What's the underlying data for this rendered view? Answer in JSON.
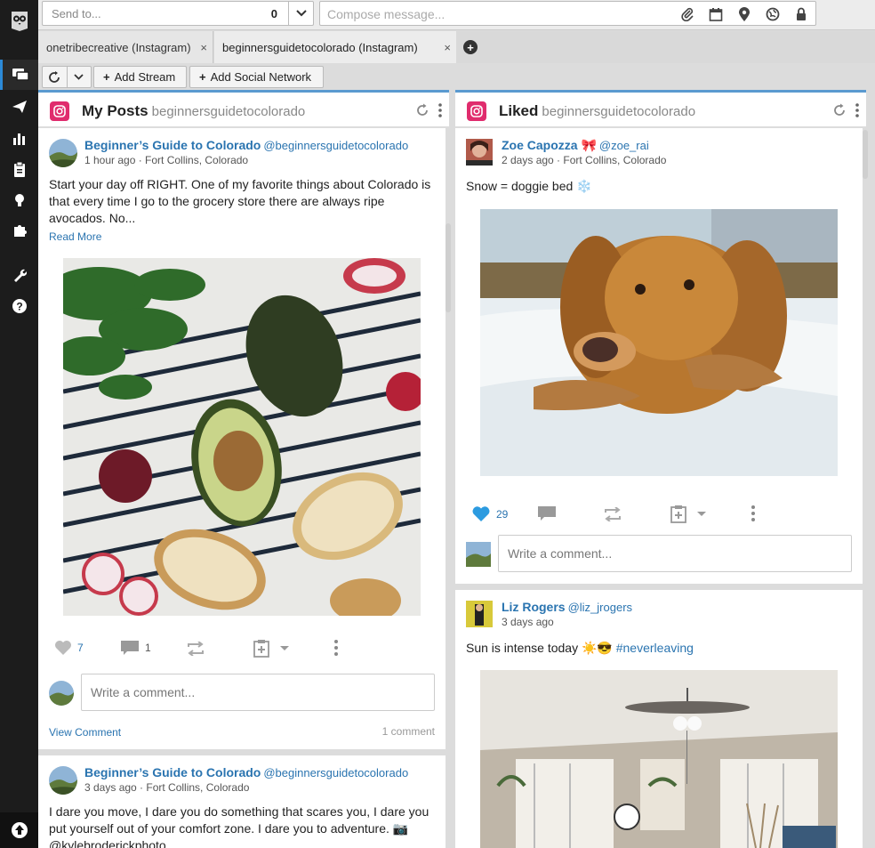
{
  "compose": {
    "send_to_placeholder": "Send to...",
    "send_to_count": "0",
    "message_placeholder": "Compose message..."
  },
  "tabs": [
    {
      "label": "onetribecreative (Instagram)",
      "close": "×"
    },
    {
      "label": "beginnersguidetocolorado (Instagram)",
      "close": "×"
    }
  ],
  "toolbar": {
    "add_stream": "Add Stream",
    "add_social_network": "Add Social Network"
  },
  "columns": [
    {
      "title": "My Posts",
      "account": "beginnersguidetocolorado",
      "posts": [
        {
          "author": "Beginner’s Guide to Colorado",
          "handle": "@beginnersguidetocolorado",
          "meta": "1 hour ago · Fort Collins, Colorado",
          "text": "Start your day off RIGHT. One of my favorite things about Colorado is that every time I go to the grocery store there are always ripe avocados. No...",
          "read_more": "Read More",
          "likes": "7",
          "comments": "1",
          "comment_placeholder": "Write a comment...",
          "view_comment": "View Comment",
          "comment_count": "1 comment"
        },
        {
          "author": "Beginner’s Guide to Colorado",
          "handle": "@beginnersguidetocolorado",
          "meta": "3 days ago · Fort Collins, Colorado",
          "text": "I dare you move, I dare you do something that scares you, I dare you put yourself out of your comfort zone. I dare you to adventure. 📷@kylebroderickphoto"
        }
      ]
    },
    {
      "title": "Liked",
      "account": "beginnersguidetocolorado",
      "posts": [
        {
          "author": "Zoe Capozza 🎀",
          "handle": "@zoe_rai",
          "meta": "2 days ago · Fort Collins, Colorado",
          "text": "Snow = doggie bed ❄️",
          "likes": "29",
          "comment_placeholder": "Write a comment..."
        },
        {
          "author": "Liz Rogers",
          "handle": "@liz_jrogers",
          "meta": "3 days ago",
          "text": "Sun is intense today ☀️😎",
          "hashtag": "#neverleaving"
        }
      ]
    }
  ],
  "colors": {
    "sidebar": "#1c1c1c",
    "link": "#2a74b0",
    "instagram": "#e02c6d",
    "like_active": "#2c9be0"
  }
}
